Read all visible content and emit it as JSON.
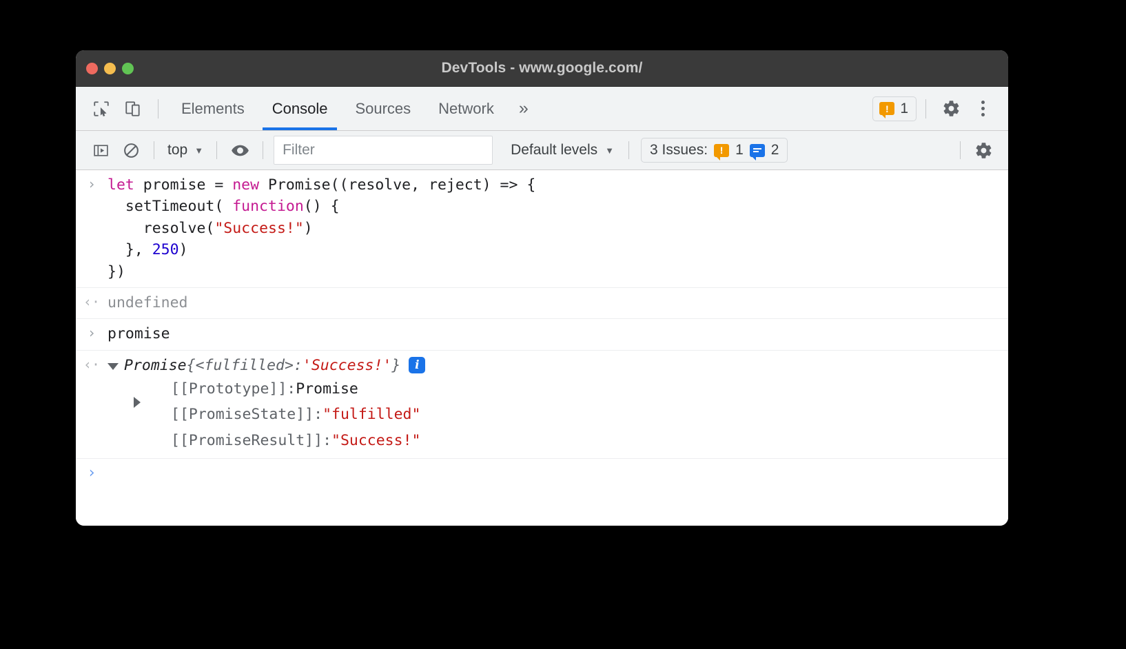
{
  "window": {
    "title": "DevTools - www.google.com/",
    "traffic_lights": [
      "close",
      "minimize",
      "zoom"
    ]
  },
  "tabbar": {
    "inspect_icon": "inspect-element-icon",
    "device_icon": "device-toolbar-icon",
    "tabs": [
      {
        "label": "Elements",
        "active": false
      },
      {
        "label": "Console",
        "active": true
      },
      {
        "label": "Sources",
        "active": false
      },
      {
        "label": "Network",
        "active": false
      }
    ],
    "more_tabs": "»",
    "warning_chip": {
      "icon": "warning-bubble-icon",
      "count": "1"
    },
    "settings_icon": "gear-icon",
    "kebab_icon": "more-options-icon"
  },
  "filterbar": {
    "sidebar_toggle_icon": "console-sidebar-icon",
    "clear_console_icon": "clear-console-icon",
    "context": {
      "label": "top",
      "caret": "▼"
    },
    "eye_icon": "live-expression-icon",
    "filter": {
      "placeholder": "Filter",
      "value": ""
    },
    "levels": {
      "label": "Default levels",
      "caret": "▼"
    },
    "issues": {
      "label": "3 Issues:",
      "warning_count": "1",
      "info_count": "2"
    },
    "settings_icon": "gear-icon"
  },
  "console": {
    "entries": [
      {
        "type": "input",
        "gutter": "›",
        "lines": [
          [
            {
              "t": "let ",
              "c": "kw"
            },
            {
              "t": "promise = ",
              "c": "plain"
            },
            {
              "t": "new ",
              "c": "kw"
            },
            {
              "t": "Promise((resolve, reject) => {",
              "c": "plain"
            }
          ],
          [
            {
              "t": "  setTimeout( ",
              "c": "plain"
            },
            {
              "t": "function",
              "c": "kw"
            },
            {
              "t": "() {",
              "c": "plain"
            }
          ],
          [
            {
              "t": "    resolve(",
              "c": "plain"
            },
            {
              "t": "\"Success!\"",
              "c": "str"
            },
            {
              "t": ")",
              "c": "plain"
            }
          ],
          [
            {
              "t": "  }, ",
              "c": "plain"
            },
            {
              "t": "250",
              "c": "num"
            },
            {
              "t": ")",
              "c": "plain"
            }
          ],
          [
            {
              "t": "})",
              "c": "plain"
            }
          ]
        ]
      },
      {
        "type": "output",
        "gutter": "‹·",
        "text": "undefined"
      },
      {
        "type": "input",
        "gutter": "›",
        "lines": [
          [
            {
              "t": "promise",
              "c": "plain"
            }
          ]
        ]
      }
    ],
    "result_object": {
      "gutter": "‹·",
      "expander": "▼",
      "constructor": "Promise",
      "brace_open": " {",
      "state_key": "<fulfilled>",
      "colon": ": ",
      "value": "'Success!'",
      "brace_close": "}",
      "info_badge": "i",
      "properties": [
        {
          "expander": "▶",
          "name": "[[Prototype]]",
          "sep": ": ",
          "value": "Promise",
          "value_kind": "plain"
        },
        {
          "expander": "",
          "name": "[[PromiseState]]",
          "sep": ": ",
          "value": "\"fulfilled\"",
          "value_kind": "string"
        },
        {
          "expander": "",
          "name": "[[PromiseResult]]",
          "sep": ": ",
          "value": "\"Success!\"",
          "value_kind": "string"
        }
      ]
    },
    "prompt": {
      "chevron": "›"
    }
  },
  "colors": {
    "accent": "#1a73e8",
    "warning": "#f29900",
    "keyword": "#c41a91",
    "string": "#c41a16",
    "number": "#1c00cf",
    "titlebar": "#3a3a3a",
    "toolbar": "#f1f3f4"
  }
}
